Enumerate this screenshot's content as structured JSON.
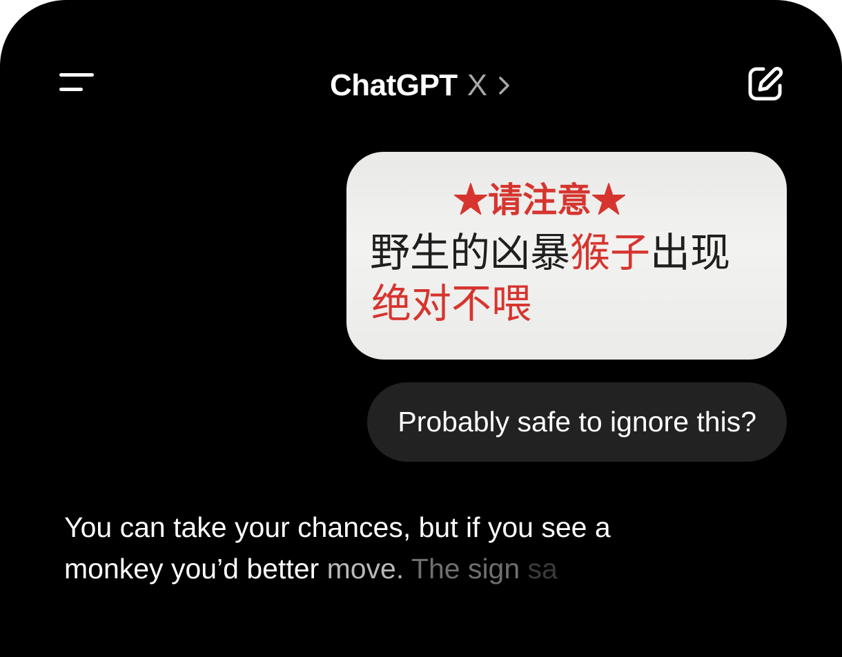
{
  "header": {
    "title": "ChatGPT",
    "model_badge": "X",
    "icons": {
      "menu": "menu-icon",
      "chevron": "chevron-right-icon",
      "new_chat": "compose-icon"
    }
  },
  "conversation": {
    "user_image": {
      "heading": "★请注意★",
      "body_prefix": "野生的凶暴",
      "body_highlight": "猴子",
      "body_suffix": "出现",
      "warning": "绝对不喂"
    },
    "user_message": "Probably safe to ignore this?",
    "assistant_reply": {
      "line1": "You can take your chances, but if you see a",
      "line2_solid": "monkey you’d better ",
      "line2_fade1": "move.",
      "line2_fade2": " The sign",
      "line2_fade3": " sa"
    }
  },
  "colors": {
    "background": "#000000",
    "user_bubble": "#222222",
    "sign_red": "#d6352f",
    "muted_text": "#a7a7a7"
  }
}
